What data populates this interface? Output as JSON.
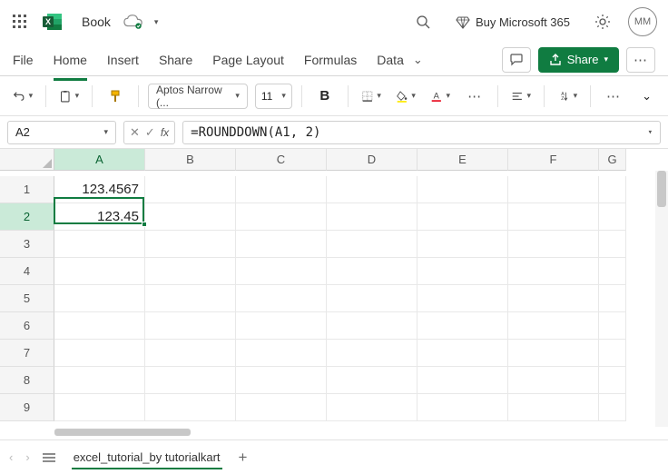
{
  "titlebar": {
    "doc_name": "Book",
    "buy_label": "Buy Microsoft 365",
    "avatar_initials": "MM"
  },
  "menu": {
    "file": "File",
    "home": "Home",
    "insert": "Insert",
    "share": "Share",
    "page_layout": "Page Layout",
    "formulas": "Formulas",
    "data": "Data",
    "share_button": "Share"
  },
  "toolbar": {
    "font_name": "Aptos Narrow (...",
    "font_size": "11",
    "bold": "B"
  },
  "formula_bar": {
    "name_box": "A2",
    "fx": "fx",
    "formula": "=ROUNDDOWN(A1, 2)"
  },
  "grid": {
    "col_headers": [
      "A",
      "B",
      "C",
      "D",
      "E",
      "F",
      "G"
    ],
    "row_headers": [
      "1",
      "2",
      "3",
      "4",
      "5",
      "6",
      "7",
      "8",
      "9"
    ],
    "active_col_index": 0,
    "active_row_index": 1,
    "cells": {
      "A1": "123.4567",
      "A2": "123.45"
    }
  },
  "statusbar": {
    "sheet_name": "excel_tutorial_by tutorialkart"
  }
}
